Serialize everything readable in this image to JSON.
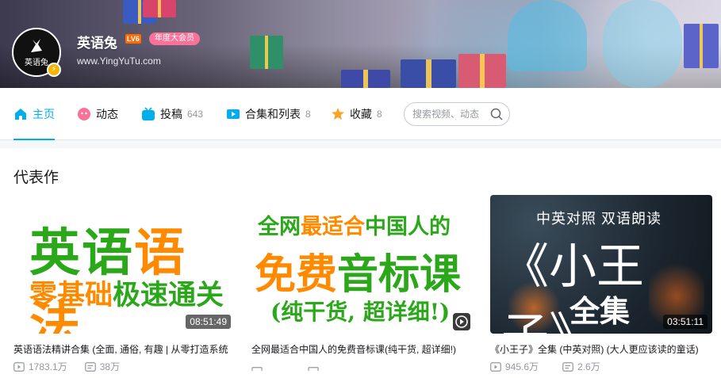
{
  "profile": {
    "name": "英语兔",
    "level": "LV6",
    "vip_badge": "年度大会员",
    "website": "www.YingYuTu.com",
    "avatar_text": "英语兔"
  },
  "nav": {
    "home": "主页",
    "dynamic": "动态",
    "posts": "投稿",
    "posts_count": "643",
    "collections": "合集和列表",
    "collections_count": "8",
    "favorites": "收藏",
    "favorites_count": "8",
    "search_placeholder": "搜索视频、动态"
  },
  "section": {
    "title": "代表作"
  },
  "videos": [
    {
      "thumb_line1": [
        "英语",
        "语法"
      ],
      "thumb_line2": [
        "零基础",
        "极速通关"
      ],
      "duration": "08:51:49",
      "title": "英语语法精讲合集 (全面, 通俗, 有趣 | 从零打造系统",
      "views": "1783.1万",
      "danmaku": "38万"
    },
    {
      "thumb_line1": [
        "全网",
        "最适合",
        "中国人的"
      ],
      "thumb_line2": [
        "免费",
        "音标课"
      ],
      "thumb_line3": "(纯干货, 超详细!)",
      "duration": "",
      "title": "全网最适合中国人的免费音标课(纯干货, 超详细!)",
      "views": "",
      "danmaku": ""
    },
    {
      "thumb_line1": "中英对照 双语朗读",
      "thumb_line2": "《小王子》",
      "thumb_line3": "全集",
      "duration": "03:51:11",
      "title": "《小王子》全集 (中英对照) (大人更应该读的童话)",
      "views": "945.6万",
      "danmaku": "2.6万"
    }
  ],
  "colors": {
    "accent": "#00aeec",
    "green": "#2aa819",
    "orange": "#ff8a00",
    "pink": "#fb7299",
    "muted": "#9499a0"
  }
}
